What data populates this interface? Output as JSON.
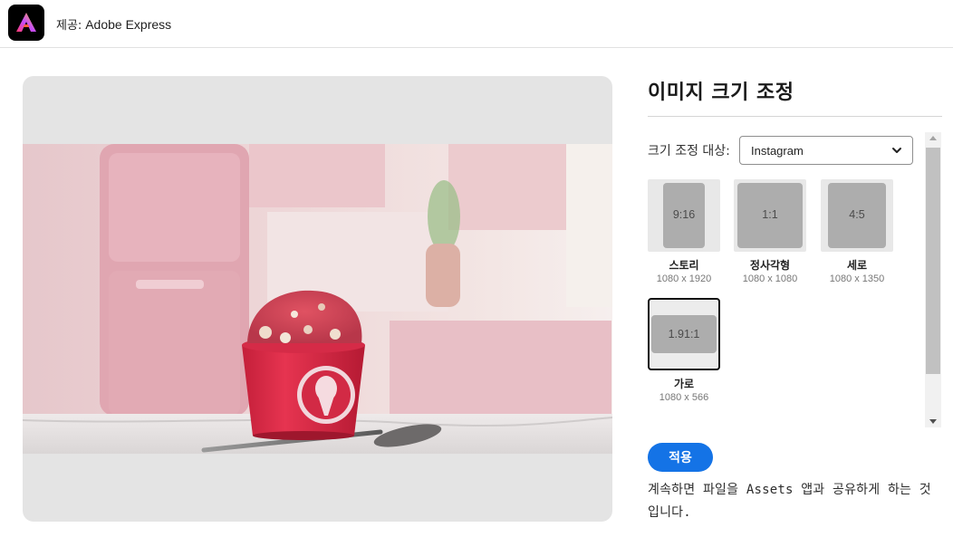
{
  "header": {
    "prefix": "제공:",
    "product": " Adobe Express"
  },
  "panel": {
    "title": "이미지 크기 조정",
    "resize_label": "크기 조정 대상:",
    "select_value": "Instagram",
    "apply_label": "적용",
    "notice": "계속하면 파일을 Assets 앱과 공유하게 하는 것입니다."
  },
  "presets": [
    {
      "ratio": "9:16",
      "name": "스토리",
      "size": "1080 x 1920",
      "selected": false
    },
    {
      "ratio": "1:1",
      "name": "정사각형",
      "size": "1080 x 1080",
      "selected": false
    },
    {
      "ratio": "4:5",
      "name": "세로",
      "size": "1080 x 1350",
      "selected": false
    },
    {
      "ratio": "1.91:1",
      "name": "가로",
      "size": "1080 x 566",
      "selected": true
    }
  ],
  "colors": {
    "accent": "#1473e6",
    "tile_bg": "#e8e8e8",
    "tile_shape": "#adadad"
  },
  "icons": {
    "logo": "adobe-express-logo",
    "select": "chevron-down-icon",
    "scroll_up": "scroll-up-arrow",
    "scroll_down": "scroll-down-arrow"
  }
}
